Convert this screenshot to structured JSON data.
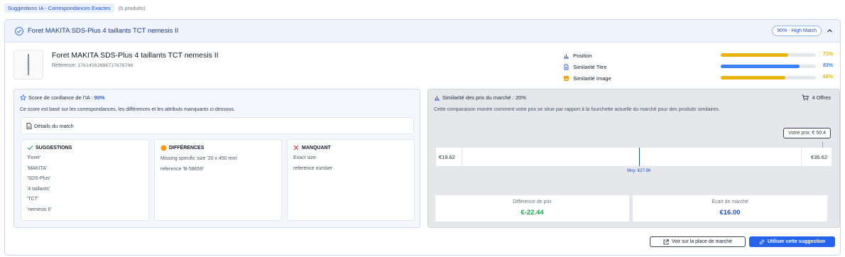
{
  "tabs": {
    "active_label": "Suggestions IA - Correspondances Exactes",
    "count_label": "(6 produits)"
  },
  "card": {
    "title": "Foret MAKITA SDS-Plus 4 taillants TCT nemesis II",
    "match_badge": "90% - High Match"
  },
  "product": {
    "name": "Foret MAKITA SDS-Plus 4 taillants TCT nemesis II",
    "reference_label": "Référence:",
    "reference_value": "17614502086717676796",
    "image_icon": "drill-bit-image"
  },
  "metrics": [
    {
      "label": "Position",
      "value": "71%",
      "percent": 71,
      "color": "#eab308",
      "icon": "bar-chart-icon"
    },
    {
      "label": "Similarité Titre",
      "value": "83%",
      "percent": 83,
      "color": "#3b82f6",
      "icon": "document-icon"
    },
    {
      "label": "Similarité Image",
      "value": "68%",
      "percent": 68,
      "color": "#eab308",
      "icon": "image-icon"
    }
  ],
  "confidence": {
    "title": "Score de confiance de l'IA :",
    "score": "90%",
    "description": "Ce score est basé sur les correspondances, les différences et les attributs manquants ci-dessous.",
    "details_label": "Détails du match",
    "suggestions": {
      "title": "SUGGESTIONS",
      "items": [
        "'Foret'",
        "'MAKITA'",
        "'SDS-Plus'",
        "'4 taillants'",
        "'TCT'",
        "'nemesis II'"
      ]
    },
    "differences": {
      "title": "DIFFÉRENCES",
      "items": [
        "Missing specific size '20 x 450 mm'",
        "reference 'B-58659'"
      ]
    },
    "missing": {
      "title": "MANQUANT",
      "items": [
        "Exact size",
        "reference number"
      ]
    }
  },
  "price": {
    "title": "Similarité des prix du marché : 20%",
    "offers": "4 Offres",
    "description": "Cette comparaison montre comment votre prix se situe par rapport à la fourchette actuelle du marché pour des produits similaires.",
    "your_price_label": "Votre prix: € 50.4",
    "range_min": "€19.62",
    "range_max": "€35.62",
    "min_value": 19.62,
    "max_value": 35.62,
    "avg_value": 27.96,
    "avg_label": "Moy: €27.96",
    "diff_label": "Différence de prix",
    "diff_value": "€-22.44",
    "diff_color": "#16a34a",
    "gap_label": "Écart de marché",
    "gap_value": "€16.00",
    "gap_color": "#1d4ed8"
  },
  "actions": {
    "marketplace_label": "Voir sur la place de marché",
    "use_label": "Utiliser cette suggestion"
  }
}
